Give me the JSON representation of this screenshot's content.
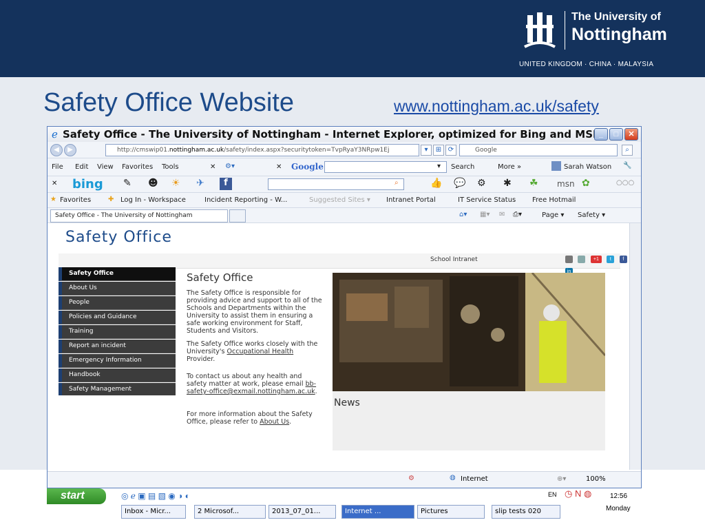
{
  "banner": {
    "logo_line1": "The University of",
    "logo_line2": "Nottingham",
    "logo_tagline": "UNITED KINGDOM · CHINA · MALAYSIA"
  },
  "slide": {
    "title": "Safety Office Website",
    "link": "www.nottingham.ac.uk/safety"
  },
  "browser": {
    "title": "Safety Office - The University of Nottingham - Internet Explorer, optimized for Bing and MSN",
    "address_prefix": "http://cmswip01.",
    "address_domain": "nottingham.ac.uk",
    "address_path": "/safety/index.aspx?securitytoken=TvpRyaY3NRpw1Ej",
    "search_placeholder": "Google",
    "menu": [
      "File",
      "Edit",
      "View",
      "Favorites",
      "Tools"
    ],
    "google_label": "Google",
    "search_btn": "Search",
    "more_btn": "More »",
    "user_name": "Sarah Watson",
    "bing_label": "bing",
    "msn_label": "msn",
    "favorites": {
      "label": "Favorites",
      "items": [
        "Log In - Workspace",
        "Incident Reporting - W...",
        "Suggested Sites ▾",
        "Intranet Portal",
        "IT Service Status",
        "Free Hotmail"
      ]
    },
    "tab_title": "Safety Office - The University of Nottingham",
    "tab_tools": {
      "page": "Page ▾",
      "safety": "Safety ▾"
    },
    "status_zone": "Internet",
    "zoom": "100%"
  },
  "site": {
    "title": "Safety Office",
    "school_intranet": "School Intranet",
    "nav": [
      "Safety Office",
      "About Us",
      "People",
      "Policies and Guidance",
      "Training",
      "Report an incident",
      "Emergency Information",
      "Handbook",
      "Safety Management"
    ],
    "heading": "Safety Office",
    "p1": "The Safety Office is responsible for providing advice and support to all of the Schools and Departments within the University to assist them in ensuring a safe working environment for Staff, Students and Visitors.",
    "p2_a": "The Safety Office works closely with the University's ",
    "p2_link": "Occupational Health",
    "p2_b": " Provider.",
    "p3_a": "To contact us about any health and safety matter at work, please email ",
    "p3_link": "bb-safety-office@exmail.nottingham.ac.uk",
    "p3_b": ".",
    "p4_a": "For more information about the Safety Office, please refer to ",
    "p4_link": "About Us",
    "p4_b": ".",
    "news_title": "News"
  },
  "taskbar": {
    "start": "start",
    "buttons": [
      "Inbox - Micr...",
      "2 Microsof...",
      "2013_07_01...",
      "Internet ...",
      "Pictures",
      "slip tests 020"
    ],
    "lang": "EN",
    "time": "12:56",
    "day": "Monday"
  },
  "colors": {
    "banner": "#14325c",
    "slide_title": "#1d4b8a",
    "nav_bg": "#3c3c3c",
    "start_green": "#2f8a26"
  }
}
